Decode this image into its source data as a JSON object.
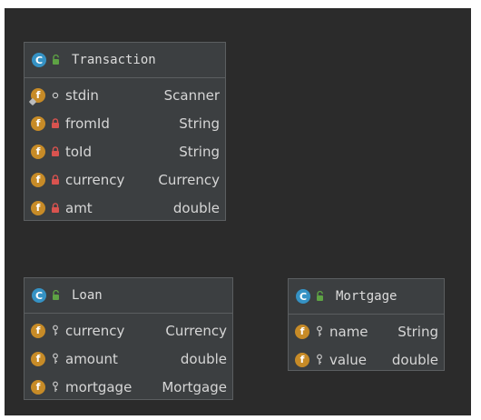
{
  "colors": {
    "canvas": "#2b2b2b",
    "node_bg": "#3c3f41",
    "node_border": "#5b5e60",
    "class_badge": "#3592c4",
    "field_badge": "#c78b27",
    "private_lock": "#d9534f",
    "public_lock": "#5ea344",
    "text": "#d6d6d6"
  },
  "classes": [
    {
      "name": "Transaction",
      "badge": "C",
      "icon": "class-icon",
      "fields": [
        {
          "badge": "f",
          "visibility": "package-circle",
          "name": "stdin",
          "type": "Scanner"
        },
        {
          "badge": "f",
          "visibility": "private-lock",
          "name": "fromId",
          "type": "String"
        },
        {
          "badge": "f",
          "visibility": "private-lock",
          "name": "toId",
          "type": "String"
        },
        {
          "badge": "f",
          "visibility": "private-lock",
          "name": "currency",
          "type": "Currency"
        },
        {
          "badge": "f",
          "visibility": "private-lock",
          "name": "amt",
          "type": "double"
        }
      ]
    },
    {
      "name": "Loan",
      "badge": "C",
      "icon": "class-icon",
      "fields": [
        {
          "badge": "f",
          "visibility": "package-key",
          "name": "currency",
          "type": "Currency"
        },
        {
          "badge": "f",
          "visibility": "package-key",
          "name": "amount",
          "type": "double"
        },
        {
          "badge": "f",
          "visibility": "package-key",
          "name": "mortgage",
          "type": "Mortgage"
        }
      ]
    },
    {
      "name": "Mortgage",
      "badge": "C",
      "icon": "class-icon",
      "fields": [
        {
          "badge": "f",
          "visibility": "package-key",
          "name": "name",
          "type": "String"
        },
        {
          "badge": "f",
          "visibility": "package-key",
          "name": "value",
          "type": "double"
        }
      ]
    }
  ]
}
